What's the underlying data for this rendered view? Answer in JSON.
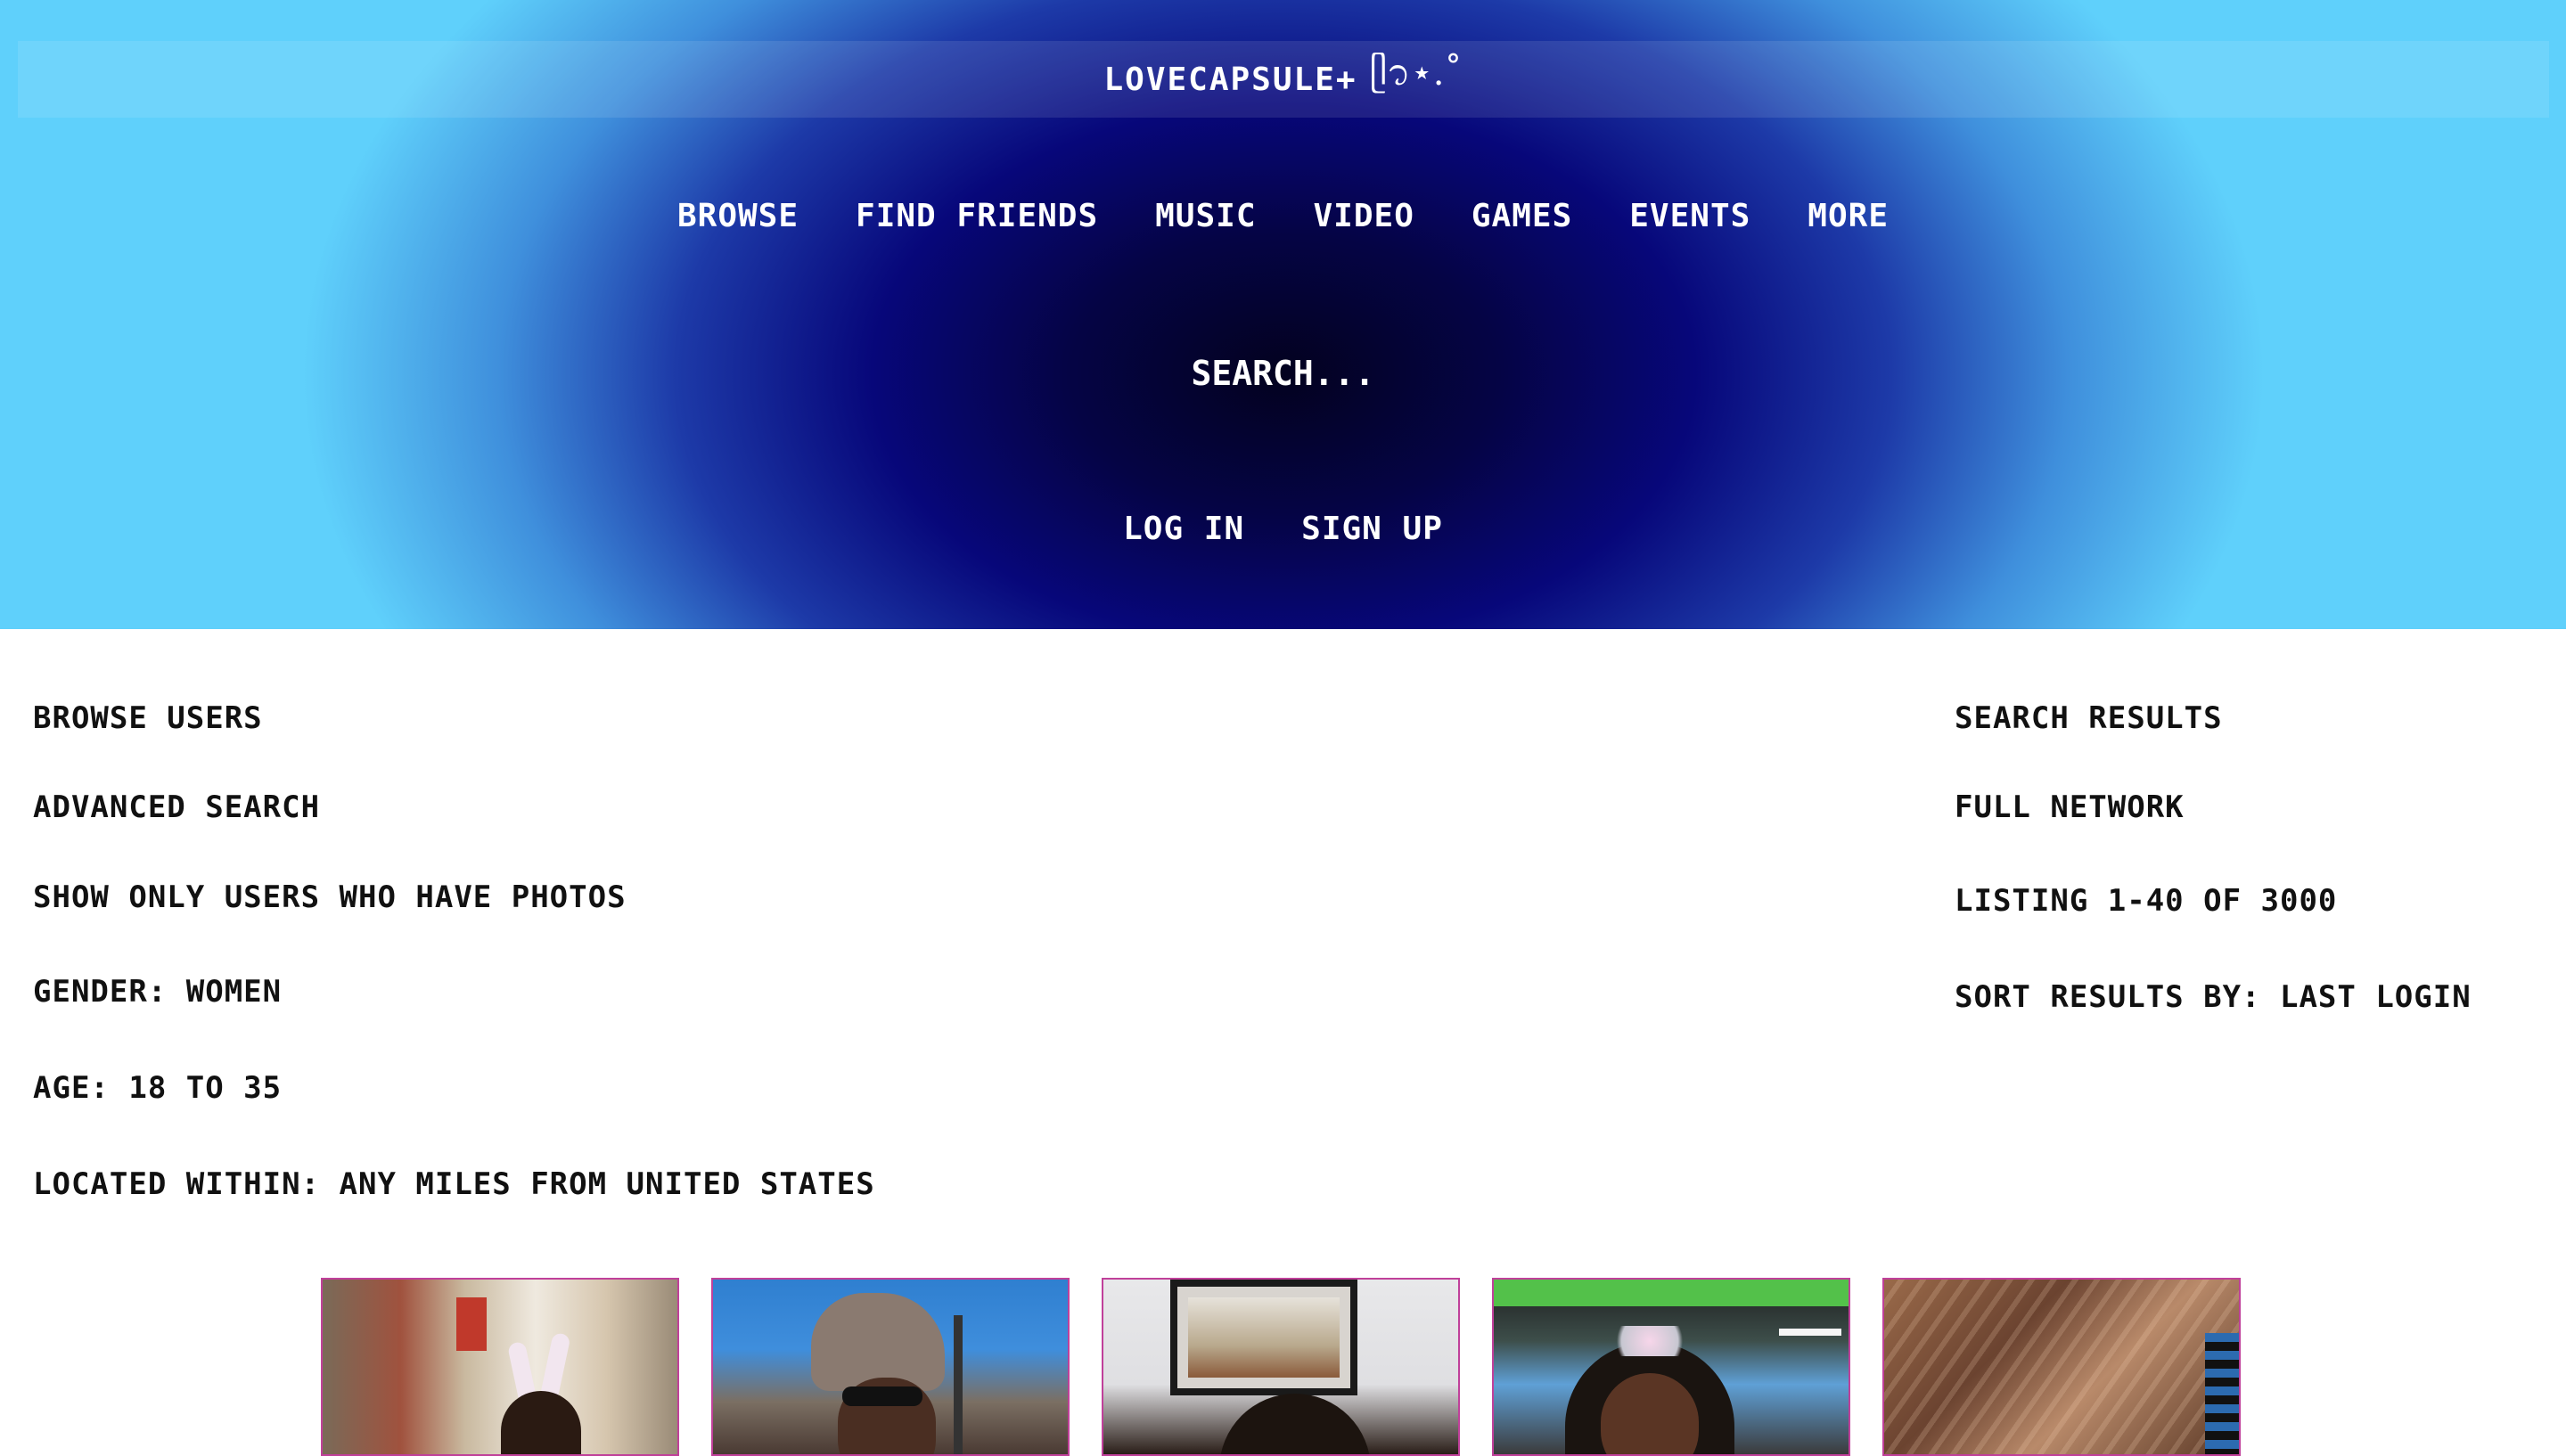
{
  "header": {
    "site_title": "LOVECAPSULE+",
    "title_decoration": "ᥫ᭡⋆.˚",
    "nav": [
      "BROWSE",
      "FIND FRIENDS",
      "MUSIC",
      "VIDEO",
      "GAMES",
      "EVENTS",
      "MORE"
    ],
    "search_placeholder": "SEARCH...",
    "auth": {
      "login": "LOG IN",
      "signup": "SIGN UP"
    }
  },
  "left": {
    "browse_users": "BROWSE USERS",
    "advanced_search": "ADVANCED SEARCH",
    "show_photos": "SHOW ONLY USERS WHO HAVE PHOTOS",
    "gender": "GENDER: WOMEN",
    "age": "AGE: 18 TO 35",
    "located": "LOCATED WITHIN: ANY MILES FROM UNITED STATES"
  },
  "right": {
    "search_results": "SEARCH RESULTS",
    "full_network": "FULL NETWORK",
    "listing": "LISTING 1-40 OF 3000",
    "sort": "SORT RESULTS BY: LAST LOGIN"
  },
  "colors": {
    "header_center": "#03021f",
    "header_mid": "#07077a",
    "header_edge": "#5fd0fb",
    "photo_border": "#c0409a"
  }
}
